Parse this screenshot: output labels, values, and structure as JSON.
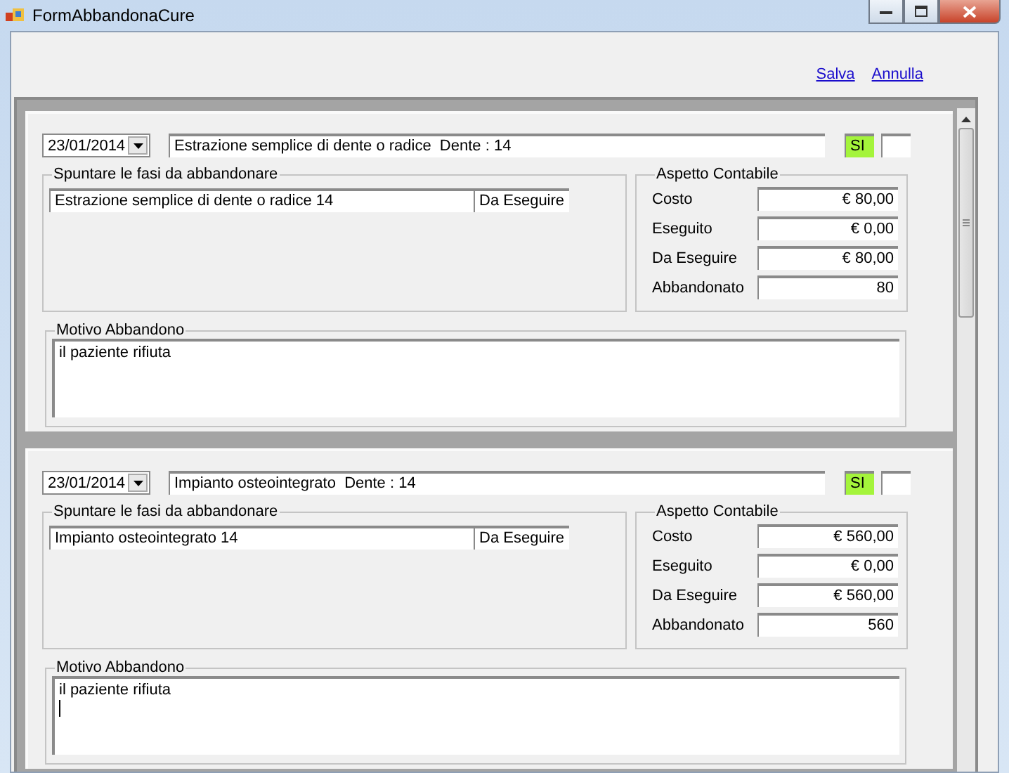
{
  "window": {
    "title": "FormAbbandonaCure"
  },
  "links": [
    {
      "label": "Salva"
    },
    {
      "label": "Annulla"
    }
  ],
  "records": [
    {
      "date": "23/01/2014",
      "description": "Estrazione semplice di dente o radice  Dente : 14",
      "flag": "SI",
      "flag_on": true,
      "phases_title": "Spuntare le fasi da abbandonare",
      "phases": [
        {
          "name": "Estrazione semplice di dente o radice 14",
          "status": "Da Eseguire"
        }
      ],
      "accounting_title": "Aspetto Contabile",
      "accounting": [
        {
          "label": "Costo",
          "value": "€ 80,00"
        },
        {
          "label": "Eseguito",
          "value": "€ 0,00"
        },
        {
          "label": "Da Eseguire",
          "value": "€ 80,00"
        },
        {
          "label": "Abbandonato",
          "value": "80"
        }
      ],
      "reason_title": "Motivo Abbandono",
      "reason": "il paziente rifiuta",
      "caret": false
    },
    {
      "date": "23/01/2014",
      "description": "Impianto osteointegrato  Dente : 14",
      "flag": "SI",
      "flag_on": true,
      "phases_title": "Spuntare le fasi da abbandonare",
      "phases": [
        {
          "name": "Impianto osteointegrato 14",
          "status": "Da Eseguire"
        }
      ],
      "accounting_title": "Aspetto Contabile",
      "accounting": [
        {
          "label": "Costo",
          "value": "€ 560,00"
        },
        {
          "label": "Eseguito",
          "value": "€ 0,00"
        },
        {
          "label": "Da Eseguire",
          "value": "€ 560,00"
        },
        {
          "label": "Abbandonato",
          "value": "560"
        }
      ],
      "reason_title": "Motivo Abbandono",
      "reason": "il paziente rifiuta",
      "caret": true
    }
  ]
}
